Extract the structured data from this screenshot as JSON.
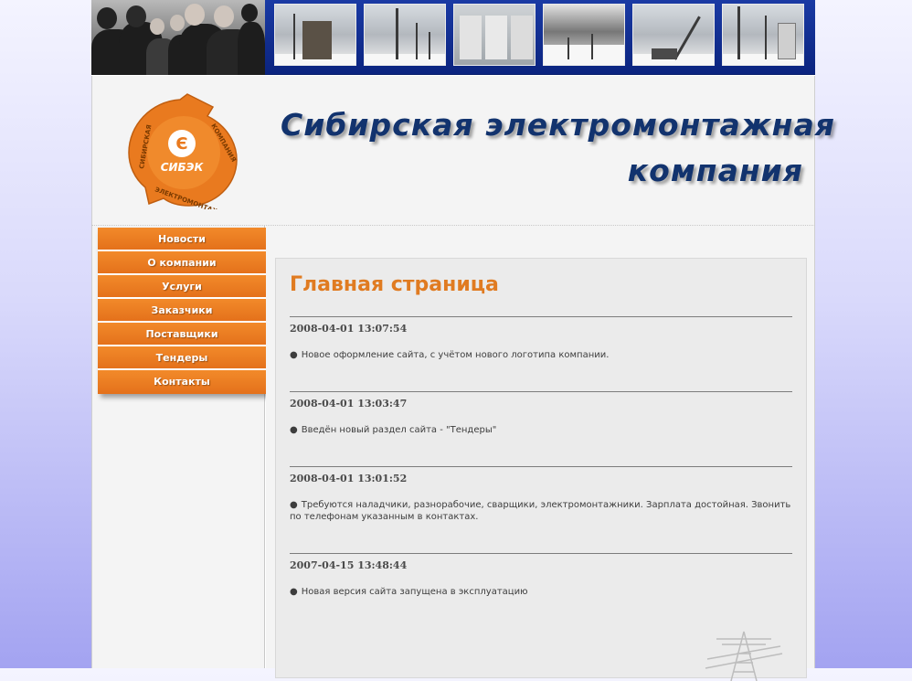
{
  "company": {
    "logo_text": "СИБЭК",
    "logo_ring_top": "КОМПАНИЯ",
    "logo_ring_left": "СИБИРСКАЯ",
    "logo_ring_bottom": "ЭЛЕКТРОМОНТАЖНАЯ",
    "title_line1": "Сибирская  электромонтажная",
    "title_line2": "компания"
  },
  "menu": {
    "items": [
      {
        "label": "Новости"
      },
      {
        "label": "О компании"
      },
      {
        "label": "Услуги"
      },
      {
        "label": "Заказчики"
      },
      {
        "label": "Поставщики"
      },
      {
        "label": "Тендеры"
      },
      {
        "label": "Контакты"
      }
    ]
  },
  "main": {
    "title": "Главная страница",
    "news": [
      {
        "date": "2008-04-01 13:07:54",
        "text": "Новое оформление сайта, с учётом нового логотипа компании."
      },
      {
        "date": "2008-04-01 13:03:47",
        "text": "Введён новый раздел сайта - \"Тендеры\""
      },
      {
        "date": "2008-04-01 13:01:52",
        "text": "Требуются наладчики, разнорабочие, сварщики, электромонтажники. Зарплата достойная. Звонить по телефонам указанным в контактах."
      },
      {
        "date": "2007-04-15 13:48:44",
        "text": "Новая версия сайта запущена в эксплуатацию"
      }
    ]
  },
  "colors": {
    "accent_orange": "#e4711b",
    "title_blue": "#12336e",
    "header_band": "#0b247f"
  },
  "icons": {
    "bullet": "●"
  }
}
